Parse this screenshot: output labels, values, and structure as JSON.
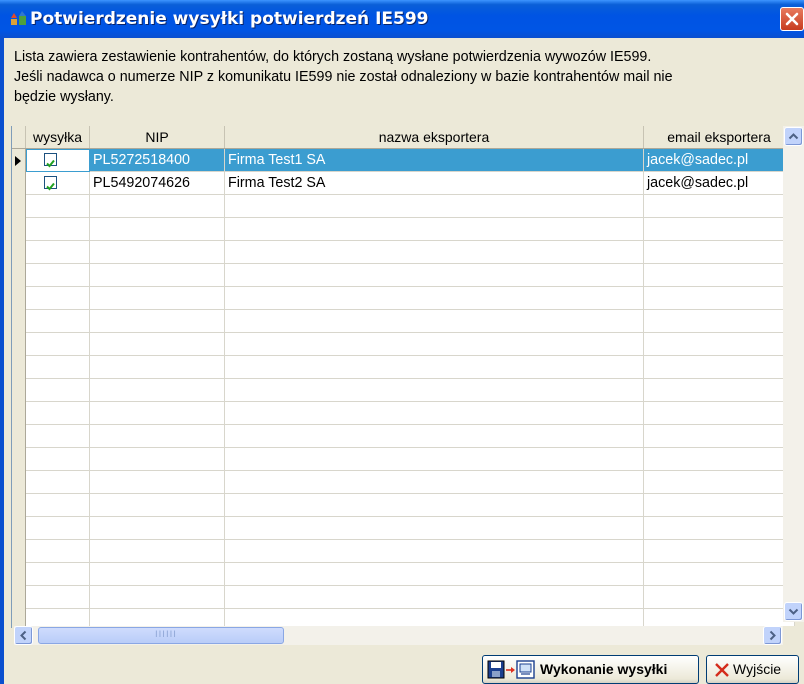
{
  "window": {
    "title": "Potwierdzenie wysyłki potwierdzeń IE599"
  },
  "info": {
    "line1": "Lista zawiera zestawienie kontrahentów, do których zostaną wysłane potwierdzenia wywozów IE599.",
    "line2": "Jeśli nadawca o numerze NIP z komunikatu IE599 nie został odnaleziony w bazie kontrahentów mail nie",
    "line3": "będzie wysłany."
  },
  "table": {
    "columns": [
      "wysyłka",
      "NIP",
      "nazwa eksportera",
      "email eksportera"
    ],
    "rows": [
      {
        "checked": true,
        "nip": "PL5272518400",
        "name": "Firma Test1 SA",
        "email": "jacek@sadec.pl",
        "selected": true
      },
      {
        "checked": true,
        "nip": "PL5492074626",
        "name": "Firma Test2 SA",
        "email": "jacek@sadec.pl",
        "selected": false
      }
    ]
  },
  "scrollbar_grip": "IIIIII",
  "buttons": {
    "execute_label": "Wykonanie wysyłki",
    "exit_label": "Wyjście"
  },
  "icons": [
    "app-icon",
    "close-icon",
    "save-arrow-icon",
    "send-icon",
    "red-x-icon",
    "checkbox-checked-icon",
    "row-pointer-icon"
  ]
}
